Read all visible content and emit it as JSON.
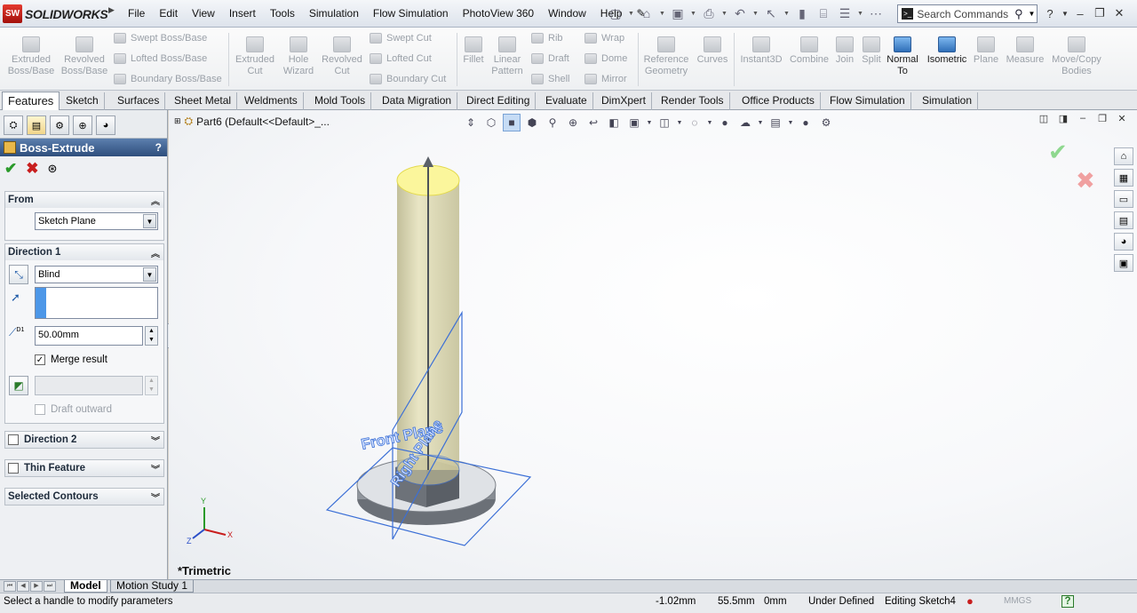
{
  "app": {
    "name": "SOLIDWORKS",
    "logo_mark": "SW"
  },
  "menus": [
    "File",
    "Edit",
    "View",
    "Insert",
    "Tools",
    "Simulation",
    "Flow Simulation",
    "PhotoView 360",
    "Window",
    "Help"
  ],
  "search": {
    "value": "Search Commands"
  },
  "title_controls": {
    "help": "?",
    "minimize": "–",
    "restore": "❐",
    "close": "✕"
  },
  "commands": {
    "extruded_boss": "Extruded Boss/Base",
    "revolved_boss": "Revolved Boss/Base",
    "swept_boss": "Swept Boss/Base",
    "lofted_boss": "Lofted Boss/Base",
    "boundary_boss": "Boundary Boss/Base",
    "extruded_cut": "Extruded Cut",
    "hole_wizard": "Hole Wizard",
    "revolved_cut": "Revolved Cut",
    "swept_cut": "Swept Cut",
    "lofted_cut": "Lofted Cut",
    "boundary_cut": "Boundary Cut",
    "fillet": "Fillet",
    "linear_pattern": "Linear Pattern",
    "rib": "Rib",
    "draft": "Draft",
    "shell": "Shell",
    "wrap": "Wrap",
    "dome": "Dome",
    "mirror": "Mirror",
    "reference_geometry": "Reference Geometry",
    "curves": "Curves",
    "instant3d": "Instant3D",
    "combine": "Combine",
    "join": "Join",
    "split": "Split",
    "normal_to": "Normal To",
    "isometric": "Isometric",
    "plane": "Plane",
    "measure": "Measure",
    "move_copy": "Move/Copy Bodies"
  },
  "tabs": [
    "Features",
    "Sketch",
    "Surfaces",
    "Sheet Metal",
    "Weldments",
    "Mold Tools",
    "Data Migration",
    "Direct Editing",
    "Evaluate",
    "DimXpert",
    "Render Tools",
    "Office Products",
    "Flow Simulation",
    "Simulation"
  ],
  "property_manager": {
    "title": "Boss-Extrude",
    "help": "?",
    "from": {
      "label": "From",
      "value": "Sketch Plane"
    },
    "direction1": {
      "label": "Direction 1",
      "end_condition": "Blind",
      "depth": "50.00mm",
      "merge_result": "Merge result",
      "merge_checked": true,
      "draft_outward": "Draft outward",
      "depth_icon_label": "D1"
    },
    "direction2": {
      "label": "Direction 2"
    },
    "thin_feature": {
      "label": "Thin Feature"
    },
    "selected_contours": {
      "label": "Selected Contours"
    }
  },
  "graphics": {
    "tree_root": "Part6  (Default<<Default>_...",
    "view_label": "*Trimetric",
    "plane_labels": [
      "Front Plane",
      "Right Plane"
    ],
    "triad": {
      "x": "X",
      "y": "Y",
      "z": "Z"
    }
  },
  "bottom_tabs": [
    "Model",
    "Motion Study 1"
  ],
  "status": {
    "message": "Select a handle to modify parameters",
    "x": "-1.02mm",
    "y": "55.5mm",
    "z": "0mm",
    "state": "Under Defined",
    "editing": "Editing Sketch4",
    "units": "MMGS",
    "help": "?"
  },
  "colors": {
    "accent": "#2e4e7c",
    "ok": "#2a9a2a",
    "cancel": "#c81e1e",
    "plane": "#3b6fd6",
    "cylinder": "#d8d4a6"
  }
}
